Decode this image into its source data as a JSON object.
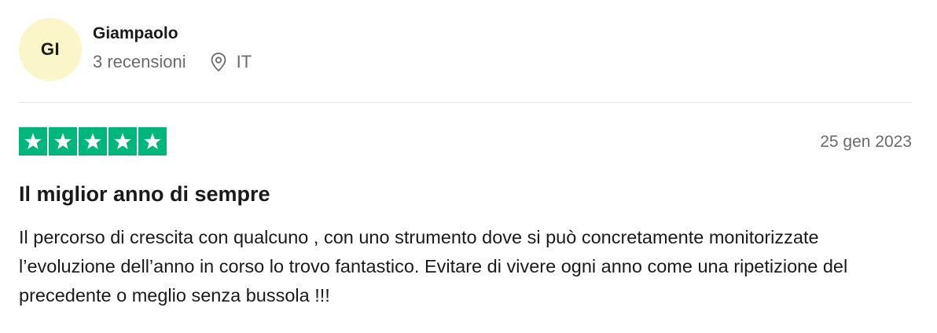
{
  "reviewer": {
    "initials": "GI",
    "name": "Giampaolo",
    "reviews_count": "3 recensioni",
    "country": "IT"
  },
  "review": {
    "rating": 5,
    "rating_max": 5,
    "date": "25 gen 2023",
    "title": "Il miglior anno di sempre",
    "body": "Il percorso di crescita con qualcuno , con uno strumento dove si può concretamente monitorizzate l’evoluzione dell’anno in corso lo trovo fantastico. Evitare di vivere ogni anno come una ripetizione del precedente o meglio senza bussola !!!"
  },
  "icons": {
    "location": "location-pin-icon",
    "star": "star-icon"
  },
  "colors": {
    "star_green": "#00b67a",
    "avatar_bg": "#fbf6c9",
    "muted_text": "#696a6a"
  }
}
